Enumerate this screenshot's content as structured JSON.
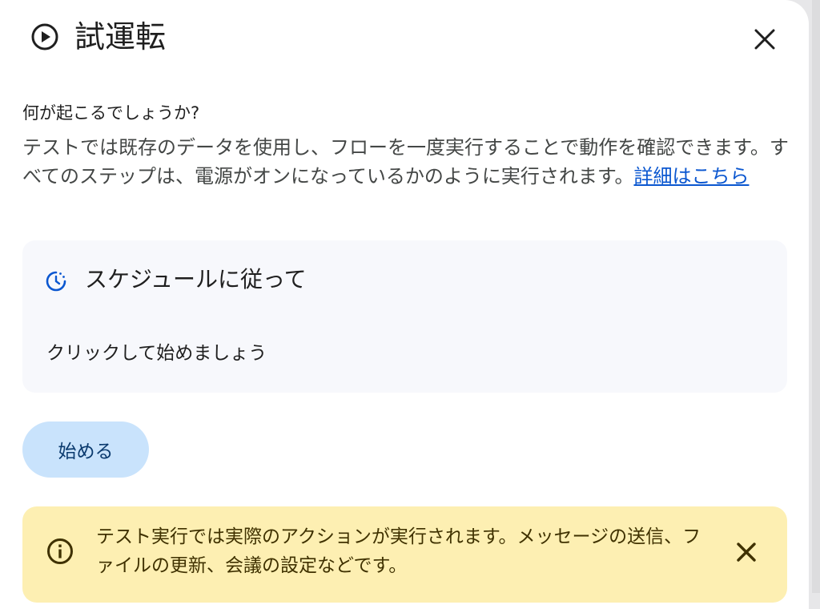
{
  "dialog": {
    "title": "試運転",
    "close_icon": "close-icon",
    "play_icon": "play-circle-icon"
  },
  "info": {
    "question": "何が起こるでしょうか?",
    "description": "テストでは既存のデータを使用し、フローを一度実行することで動作を確認できます。すべてのステップは、電源がオンになっているかのように実行されます。",
    "learn_more": "詳細はこちら"
  },
  "schedule": {
    "icon": "schedule-icon",
    "label": "スケジュールに従って",
    "hint": "クリックして始めましょう"
  },
  "actions": {
    "start_label": "始める"
  },
  "warning": {
    "icon": "info-icon",
    "text": "テスト実行では実際のアクションが実行されます。メッセージの送信、ファイルの更新、会議の設定などです。",
    "close_icon": "close-icon"
  },
  "colors": {
    "link": "#0b57d0",
    "card_bg": "#f7f8fc",
    "button_bg": "#c9e3fc",
    "warning_bg": "#fdefb2",
    "warning_text": "#3f3100"
  }
}
